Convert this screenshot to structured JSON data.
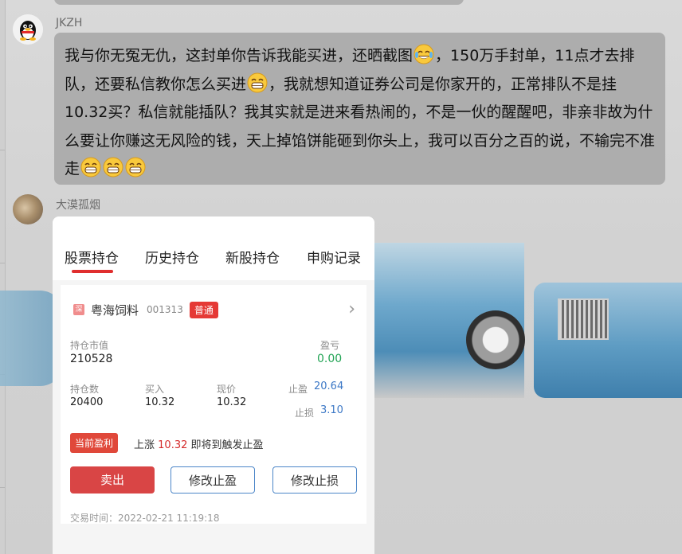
{
  "chat": {
    "message1": {
      "sender": "JKZH",
      "text_part1": "我与你无冤无仇，这封单你告诉我能买进，还晒截图",
      "text_part2": "，150万手封单，11点才去排队，还要私信教你怎么买进",
      "text_part3": "，我就想知道证券公司是你家开的，正常排队不是挂10.32买？私信就能插队？我其实就是进来看热闹的，不是一伙的醒醒吧，非亲非故为什么要让你赚这无风险的钱，天上掉馅饼能砸到你头上，我可以百分之百的说，不输完不准走"
    },
    "message2": {
      "sender": "大漠孤烟"
    }
  },
  "stock_card": {
    "tabs": [
      "股票持仓",
      "历史持仓",
      "新股持仓",
      "申购记录"
    ],
    "market_tag": "深",
    "stock_name": "粤海饲料",
    "stock_code": "001313",
    "type_tag": "普通",
    "position_value_label": "持仓市值",
    "position_value": "210528",
    "pnl_label": "盈亏",
    "pnl": "0.00",
    "qty_label": "持仓数",
    "qty": "20400",
    "buy_label": "买入",
    "buy": "10.32",
    "price_label": "现价",
    "price": "10.32",
    "take_profit_label": "止盈",
    "take_profit": "20.64",
    "stop_loss_label": "止损",
    "stop_loss": "3.10",
    "profit_badge": "当前盈利",
    "notice_prefix": "上涨",
    "notice_value": "10.32",
    "notice_suffix": "即将到触发止盈",
    "btn_sell": "卖出",
    "btn_modify_tp": "修改止盈",
    "btn_modify_sl": "修改止损",
    "trade_time": "交易时间：2022-02-21 11:19:18"
  }
}
